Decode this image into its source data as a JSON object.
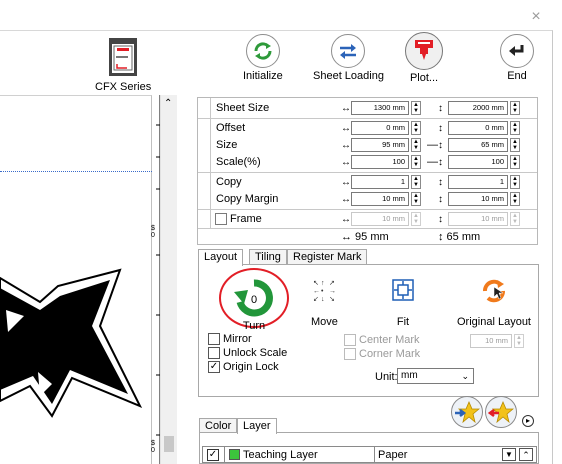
{
  "window": {
    "close_symbol": "×"
  },
  "toolbar": {
    "model_label": "CFX Series",
    "buttons": [
      {
        "label": "Initialize",
        "icon": "refresh-icon"
      },
      {
        "label": "Sheet Loading",
        "icon": "swap-arrows-icon"
      },
      {
        "label": "Plot...",
        "icon": "plotter-head-icon"
      },
      {
        "label": "End",
        "icon": "return-arrow-icon"
      }
    ]
  },
  "canvas": {
    "ruler_label": "$\n0",
    "ruler_label2": "$\n0"
  },
  "properties": {
    "rows": [
      {
        "name": "Sheet Size",
        "x": "1300 mm",
        "y": "2000 mm"
      },
      {
        "name": "Offset",
        "x": "0 mm",
        "y": "0 mm"
      },
      {
        "name": "Size",
        "x": "95 mm",
        "y": "65 mm"
      },
      {
        "name": "Scale(%)",
        "x": "100",
        "y": "100"
      },
      {
        "name": "Copy",
        "x": "1",
        "y": "1"
      },
      {
        "name": "Copy Margin",
        "x": "10 mm",
        "y": "10 mm"
      },
      {
        "name": "Frame",
        "x": "10 mm",
        "y": "10 mm"
      }
    ],
    "summary_w": "↔ 95 mm",
    "summary_h": "↕ 65 mm"
  },
  "tabs": [
    "Layout",
    "Tiling",
    "Register Mark"
  ],
  "layout_panel": {
    "actions": [
      {
        "label": "Turn",
        "icon": "turn-icon",
        "value": "0"
      },
      {
        "label": "Move",
        "icon": "move-arrows-icon"
      },
      {
        "label": "Fit",
        "icon": "fit-icon"
      },
      {
        "label": "Original Layout",
        "icon": "original-layout-icon"
      }
    ],
    "options": {
      "mirror": "Mirror",
      "unlock_scale": "Unlock Scale",
      "origin_lock": "Origin Lock",
      "center_mark": "Center Mark",
      "corner_mark": "Corner Mark"
    },
    "mark_size": "10 mm",
    "unit_label": "Unit:",
    "unit_value": "mm",
    "highlight_color": "#e21e26"
  },
  "bottom_tabs": [
    "Color",
    "Layer"
  ],
  "layer": {
    "name": "Teaching Layer",
    "media": "Paper",
    "color": "#3cc43c"
  }
}
